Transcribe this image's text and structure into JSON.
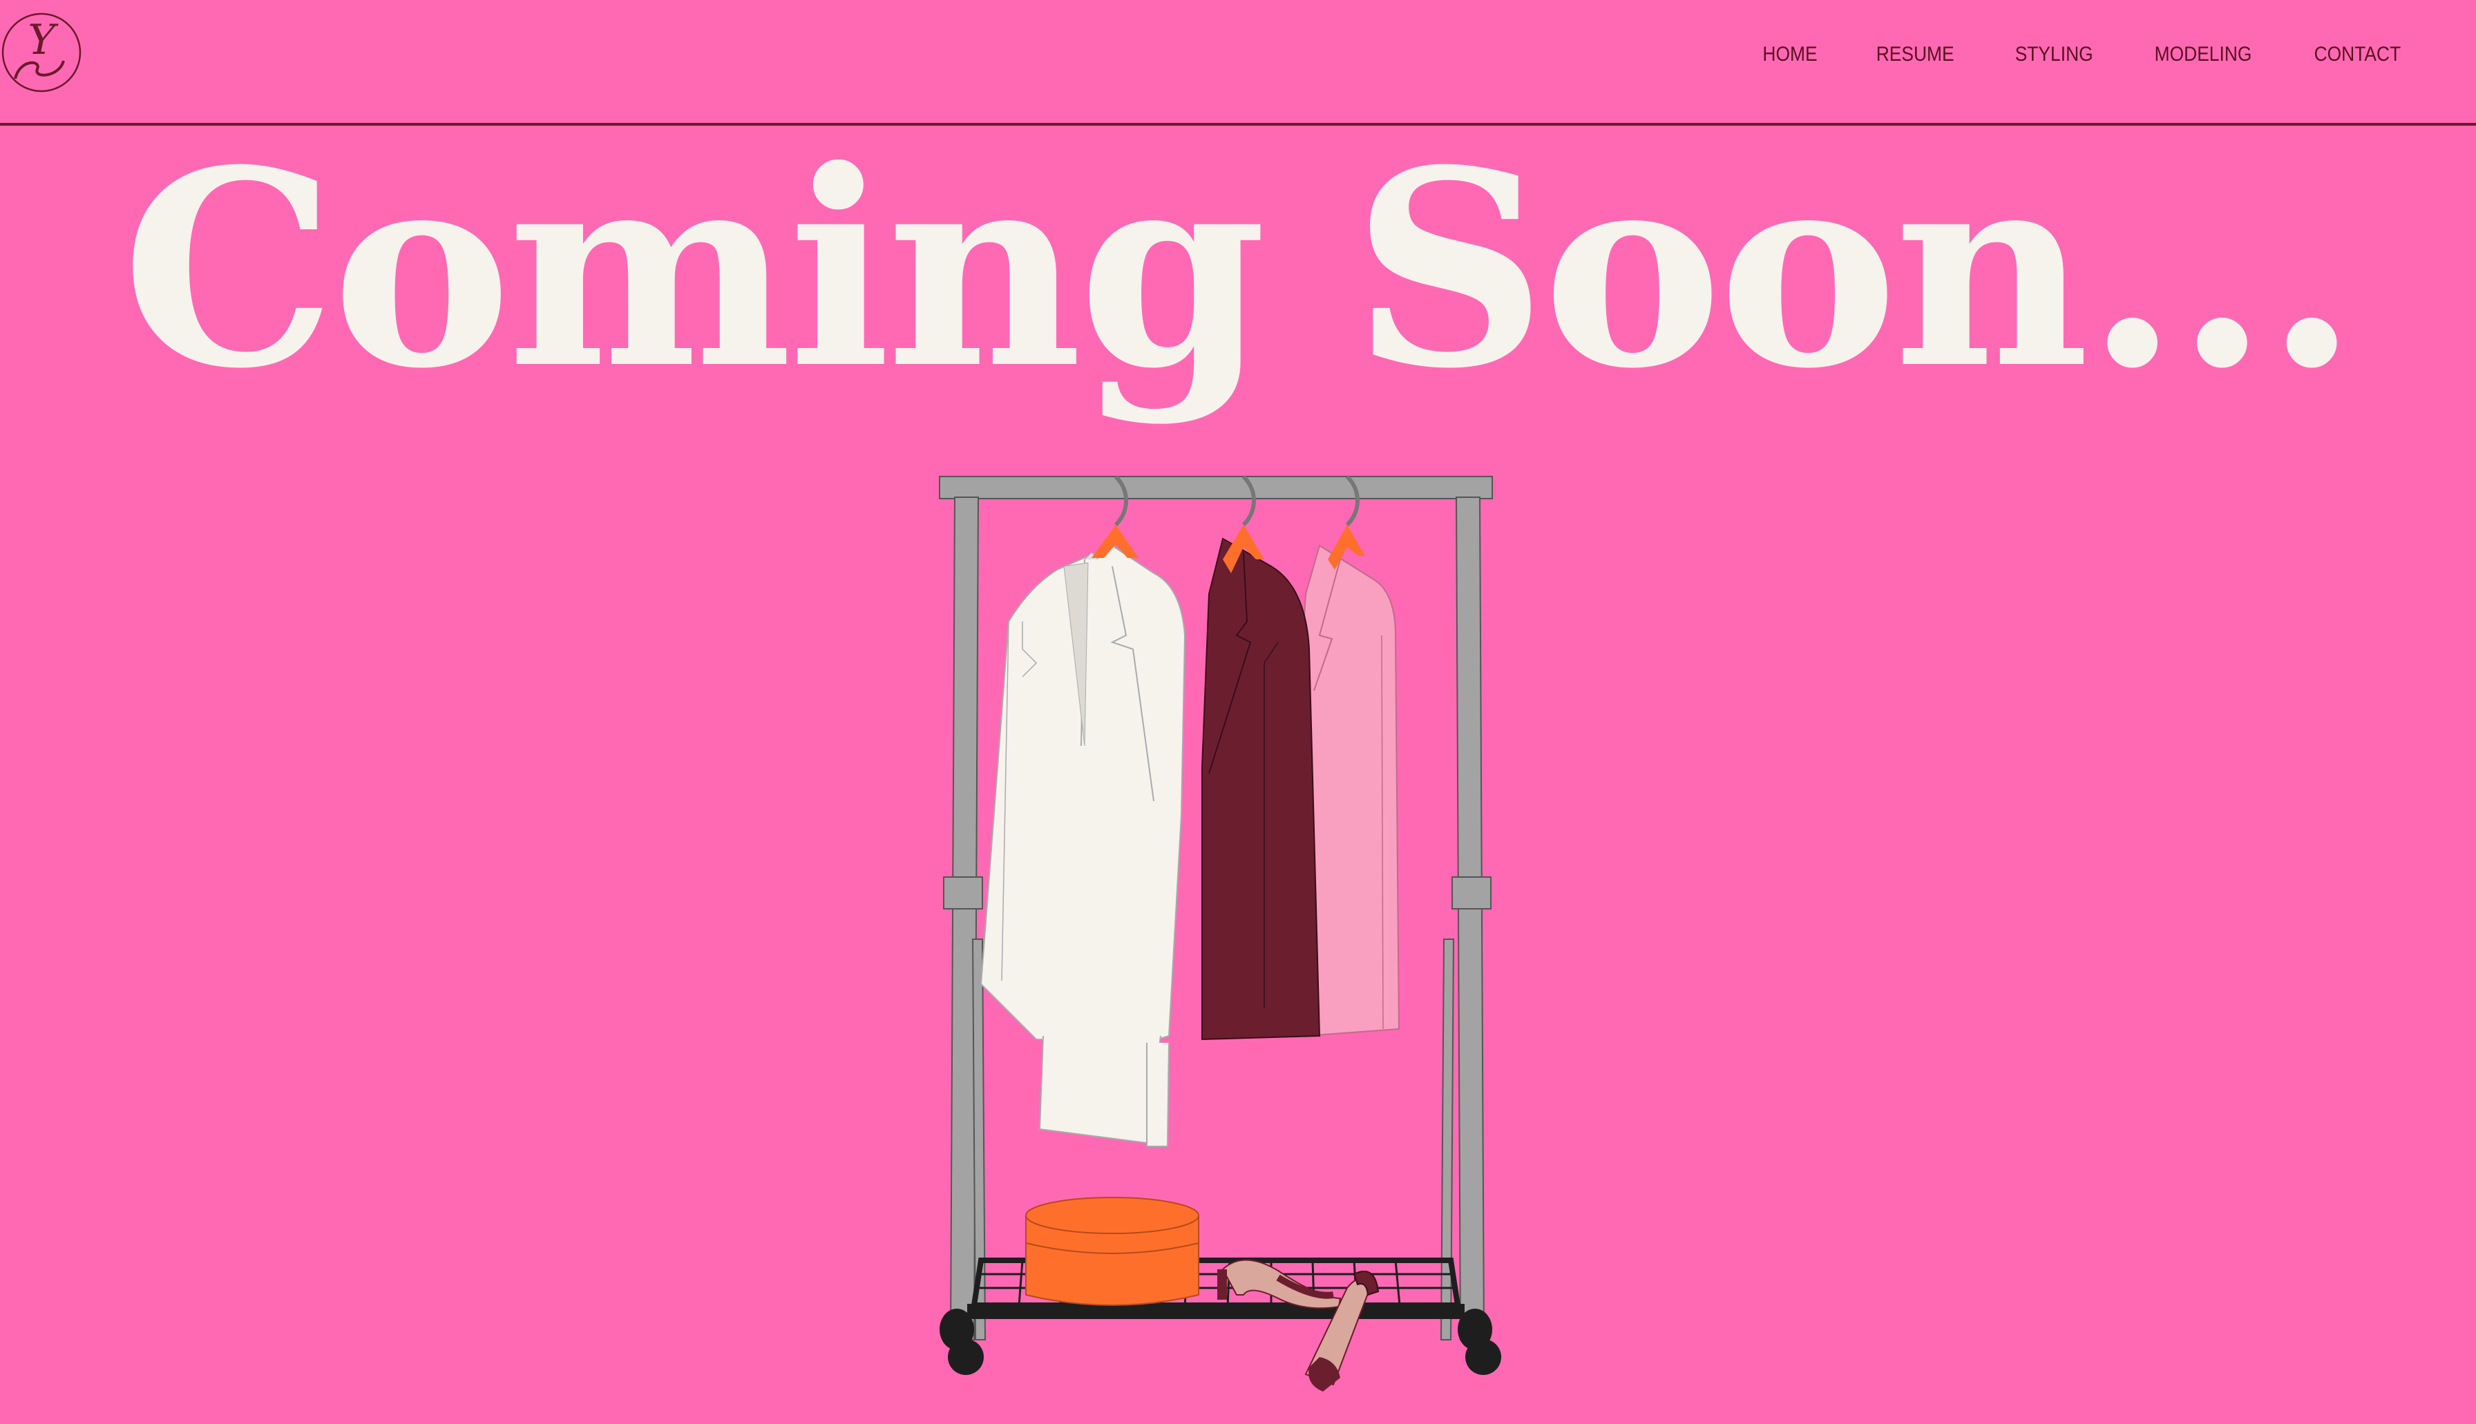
{
  "header": {
    "logo_alt": "YS",
    "nav": [
      {
        "label": "HOME"
      },
      {
        "label": "RESUME"
      },
      {
        "label": "STYLING"
      },
      {
        "label": "MODELING"
      },
      {
        "label": "CONTACT"
      }
    ]
  },
  "main": {
    "headline": "Coming Soon..."
  },
  "colors": {
    "background": "#FF69B4",
    "text_dark": "#5a0f1f",
    "headline": "#F5F3EC",
    "orange": "#FF6F2C",
    "burgundy": "#6B1F2E",
    "light_pink": "#F99FC0",
    "white_coat": "#F5F3EC",
    "rack_gray": "#A3A3A3"
  },
  "illustration": {
    "name": "clothing-rack-illustration",
    "items": [
      "white-coat",
      "burgundy-blazer",
      "pink-blazer",
      "hat-box",
      "heel-shoes"
    ]
  }
}
